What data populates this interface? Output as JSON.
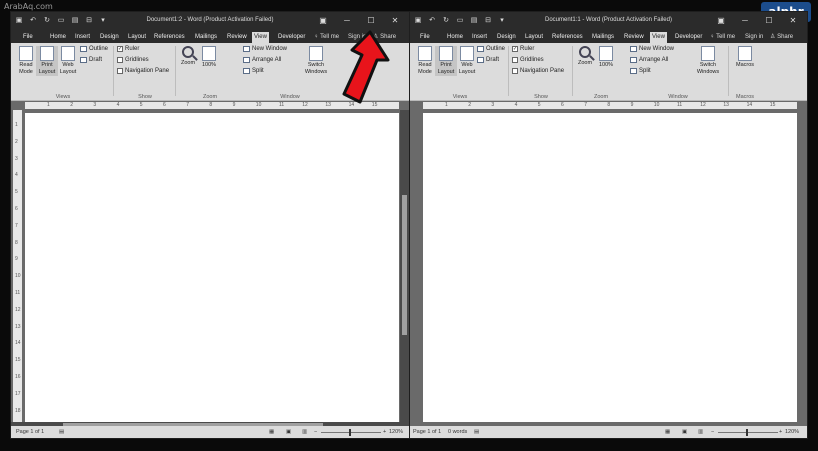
{
  "watermark": "ArabAq.com",
  "brand_logo": "alphr",
  "left": {
    "title": "Document1:2 - Word (Product Activation Failed)",
    "tabs": [
      "File",
      "Home",
      "Insert",
      "Design",
      "Layout",
      "References",
      "Mailings",
      "Review",
      "View",
      "Developer"
    ],
    "active_tab": "View",
    "tell_me": "Tell me",
    "sign_in": "Sign in",
    "share": "Share",
    "views_group": {
      "label": "Views",
      "read_mode": "Read Mode",
      "print_layout": "Print Layout",
      "web_layout": "Web Layout",
      "outline": "Outline",
      "draft": "Draft"
    },
    "show_group": {
      "label": "Show",
      "ruler": "Ruler",
      "gridlines": "Gridlines",
      "navigation_pane": "Navigation Pane"
    },
    "zoom_group": {
      "label": "Zoom",
      "zoom": "Zoom",
      "hundred": "100%"
    },
    "window_group": {
      "label": "Window",
      "new_window": "New Window",
      "arrange_all": "Arrange All",
      "split": "Split",
      "switch_windows": "Switch Windows"
    },
    "status": {
      "page": "Page 1 of 1",
      "zoom": "120%"
    }
  },
  "right": {
    "title": "Document1:1 - Word (Product Activation Failed)",
    "tabs": [
      "File",
      "Home",
      "Insert",
      "Design",
      "Layout",
      "References",
      "Mailings",
      "Review",
      "View",
      "Developer"
    ],
    "active_tab": "View",
    "tell_me": "Tell me",
    "sign_in": "Sign in",
    "share": "Share",
    "views_group": {
      "label": "Views",
      "read_mode": "Read Mode",
      "print_layout": "Print Layout",
      "web_layout": "Web Layout",
      "outline": "Outline",
      "draft": "Draft"
    },
    "show_group": {
      "label": "Show",
      "ruler": "Ruler",
      "gridlines": "Gridlines",
      "navigation_pane": "Navigation Pane"
    },
    "zoom_group": {
      "label": "Zoom",
      "zoom": "Zoom",
      "hundred": "100%"
    },
    "window_group": {
      "label": "Window",
      "new_window": "New Window",
      "arrange_all": "Arrange All",
      "split": "Split",
      "switch_windows": "Switch Windows"
    },
    "macros_group": {
      "label": "Macros",
      "macros": "Macros"
    },
    "status": {
      "page": "Page 1 of 1",
      "words": "0 words",
      "zoom": "120%"
    }
  },
  "ruler_ticks": [
    "1",
    "2",
    "3",
    "4",
    "5",
    "6",
    "7",
    "8",
    "9",
    "10",
    "11",
    "12",
    "13",
    "14",
    "15"
  ],
  "vruler_ticks": [
    "1",
    "2",
    "3",
    "4",
    "5",
    "6",
    "7",
    "8",
    "9",
    "10",
    "11",
    "12",
    "13",
    "14",
    "15",
    "16",
    "17",
    "18"
  ],
  "colors": {
    "title_bar": "#2b2b2b",
    "ribbon": "#dcdcdc",
    "arrow": "#e8141b"
  }
}
